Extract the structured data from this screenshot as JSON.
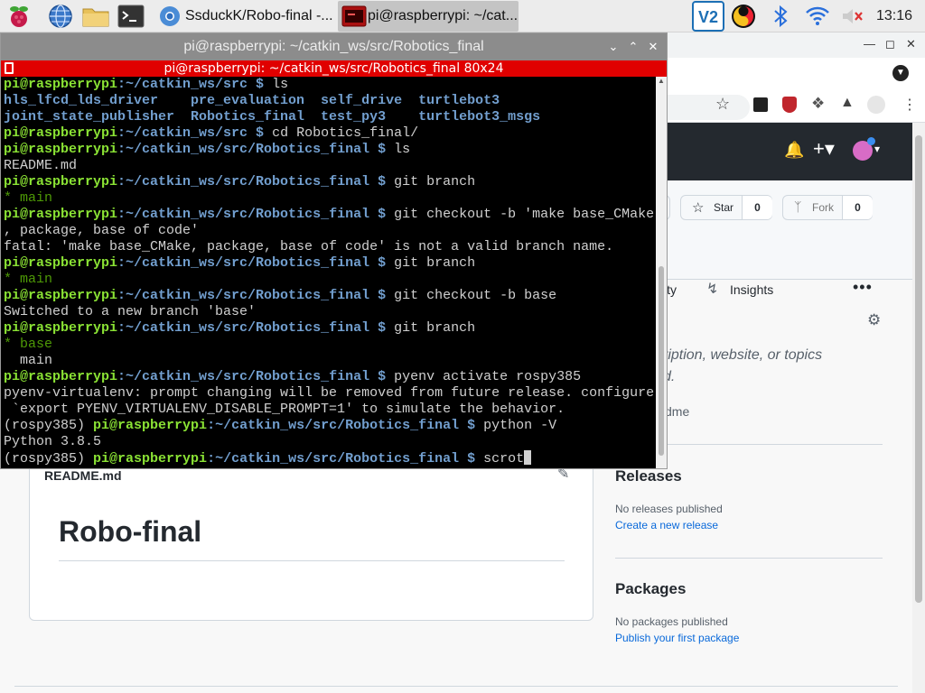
{
  "taskbar": {
    "browser_task": "SsduckK/Robo-final -...",
    "terminal_task": "pi@raspberrypi: ~/cat...",
    "clock": "13:16"
  },
  "github": {
    "star_label": "Star",
    "star_count": "0",
    "fork_label": "Fork",
    "fork_count": "0",
    "tab_activity_partial": "ity",
    "tab_insights": "Insights",
    "about_text_1": "ription, website, or topics",
    "about_text_2": "d.",
    "about_readme_partial": "dme",
    "readme_filename": "README.md",
    "readme_heading": "Robo-final",
    "releases_title": "Releases",
    "releases_none": "No releases published",
    "releases_link": "Create a new release",
    "packages_title": "Packages",
    "packages_none": "No packages published",
    "packages_link": "Publish your first package"
  },
  "terminal": {
    "window_title": "pi@raspberrypi: ~/catkin_ws/src/Robotics_final",
    "inner_title": "pi@raspberrypi: ~/catkin_ws/src/Robotics_final 80x24",
    "lines": [
      {
        "user": "pi@raspberrypi",
        "path": ":~/catkin_ws/src $ ",
        "cmd": "ls"
      },
      {
        "dirs": "hls_lfcd_lds_driver    pre_evaluation  self_drive  turtlebot3"
      },
      {
        "dirs": "joint_state_publisher  Robotics_final  test_py3    turtlebot3_msgs"
      },
      {
        "user": "pi@raspberrypi",
        "path": ":~/catkin_ws/src $ ",
        "cmd": "cd Robotics_final/"
      },
      {
        "user": "pi@raspberrypi",
        "path": ":~/catkin_ws/src/Robotics_final $ ",
        "cmd": "ls"
      },
      {
        "text": "README.md"
      },
      {
        "user": "pi@raspberrypi",
        "path": ":~/catkin_ws/src/Robotics_final $ ",
        "cmd": "git branch"
      },
      {
        "branch": "* main"
      },
      {
        "user": "pi@raspberrypi",
        "path": ":~/catkin_ws/src/Robotics_final $ ",
        "cmd": "git checkout -b 'make base_CMake"
      },
      {
        "text": ", package, base of code'"
      },
      {
        "text": "fatal: 'make base_CMake, package, base of code' is not a valid branch name."
      },
      {
        "user": "pi@raspberrypi",
        "path": ":~/catkin_ws/src/Robotics_final $ ",
        "cmd": "git branch"
      },
      {
        "branch": "* main"
      },
      {
        "user": "pi@raspberrypi",
        "path": ":~/catkin_ws/src/Robotics_final $ ",
        "cmd": "git checkout -b base"
      },
      {
        "text": "Switched to a new branch 'base'"
      },
      {
        "user": "pi@raspberrypi",
        "path": ":~/catkin_ws/src/Robotics_final $ ",
        "cmd": "git branch"
      },
      {
        "branch": "* base"
      },
      {
        "text": "  main"
      },
      {
        "user": "pi@raspberrypi",
        "path": ":~/catkin_ws/src/Robotics_final $ ",
        "cmd": "pyenv activate rospy385"
      },
      {
        "text": "pyenv-virtualenv: prompt changing will be removed from future release. configure"
      },
      {
        "text": " `export PYENV_VIRTUALENV_DISABLE_PROMPT=1' to simulate the behavior."
      },
      {
        "venv": "(rospy385) ",
        "user": "pi@raspberrypi",
        "path": ":~/catkin_ws/src/Robotics_final $ ",
        "cmd": "python -V"
      },
      {
        "text": "Python 3.8.5"
      },
      {
        "venv": "(rospy385) ",
        "user": "pi@raspberrypi",
        "path": ":~/catkin_ws/src/Robotics_final $ ",
        "cmd": "scrot",
        "cursor": true
      }
    ]
  }
}
